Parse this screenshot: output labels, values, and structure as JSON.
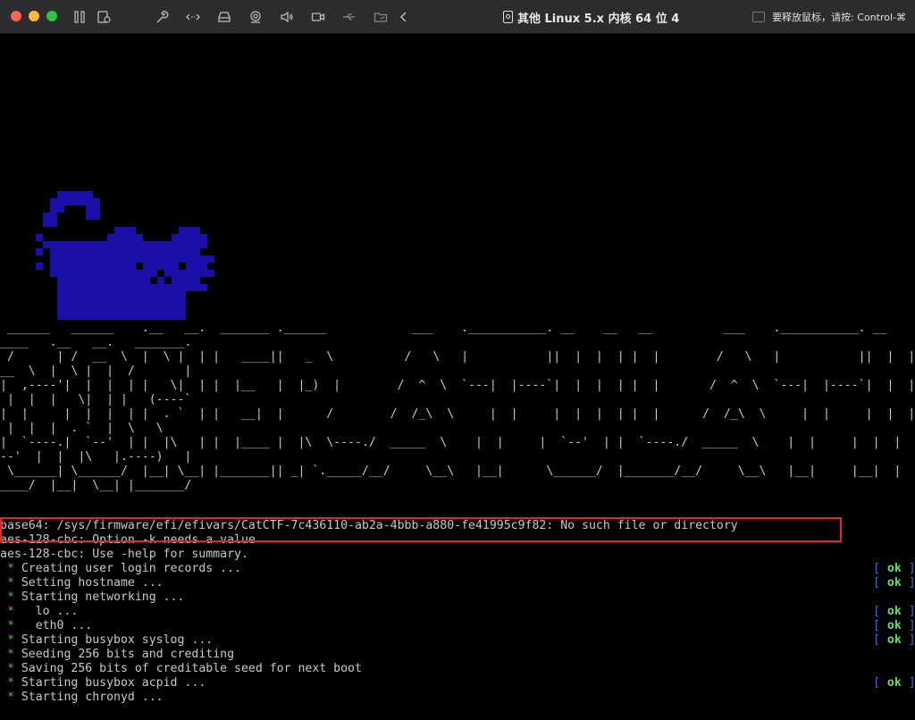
{
  "window": {
    "title": "其他 Linux 5.x 内核 64 位 4",
    "release_hint": "要释放鼠标，请按: Control-⌘",
    "traffic_lights": {
      "close": "#ff5f57",
      "minimize": "#febc2e",
      "maximize": "#28c840"
    }
  },
  "toolbar": {
    "icons": [
      "pause-icon",
      "snapshot-icon",
      "wrench-icon",
      "network-arrows-icon",
      "disk-icon",
      "camera-icon",
      "speaker-icon",
      "video-icon",
      "usb-icon",
      "shared-folder-icon",
      "chevron-left-icon"
    ]
  },
  "logo": {
    "color": "#1a0fa8"
  },
  "banner": {
    "lines": [
      " ______   ______    .__   __.  _______ .______            ___    .___________. __    __   __          ___    .___________. __    __",
      "____   .__   __.   _______.",
      " /      | /  __  \\  |  \\ |  | |   ____||   _  \\          /   \\   |           ||  |  |  | |  |        /   \\   |           ||  |  |",
      "__  \\  |  \\ |  |  /       |",
      "|  ,----'|  |  |  | |   \\|  | |  |__   |  |_)  |        /  ^  \\  `---|  |----`|  |  |  | |  |       /  ^  \\  `---|  |----`|  |  |",
      " |  |  |   \\|  | |   (----`",
      "|  |     |  |  |  | |  . `  | |   __|  |      /        /  /_\\  \\     |  |     |  |  |  | |  |      /  /_\\  \\     |  |     |  |  |",
      " |  |  |  . `  |  \\   \\",
      "|  `----.|  `--'  | |  |\\   | |  |____ |  |\\  \\----./  _____  \\    |  |     |  `--'  | |  `----./  _____  \\    |  |     |  |  |",
      "--'  |  |  |\\   |.----)   |",
      " \\______| \\______/  |__| \\__| |_______|| _| `._____/__/     \\__\\   |__|      \\______/  |_______/__/     \\__\\   |__|     |__|  |",
      "____/  |__|  \\__| |_______/"
    ]
  },
  "console": {
    "lines": [
      {
        "text": "base64: /sys/firmware/efi/efivars/CatCTF-7c436110-ab2a-4bbb-a880-fe41995c9f82: No such file or directory",
        "star": false,
        "ok": false
      },
      {
        "text": "aes-128-cbc: Option -k needs a value",
        "star": false,
        "ok": false
      },
      {
        "text": "aes-128-cbc: Use -help for summary.",
        "star": false,
        "ok": false
      },
      {
        "text": "Creating user login records ...",
        "star": true,
        "ok": true
      },
      {
        "text": "Setting hostname ...",
        "star": true,
        "ok": true
      },
      {
        "text": "Starting networking ...",
        "star": true,
        "ok": false
      },
      {
        "text": "  lo ...",
        "star": true,
        "ok": true
      },
      {
        "text": "  eth0 ...",
        "star": true,
        "ok": true
      },
      {
        "text": "Starting busybox syslog ...",
        "star": true,
        "ok": true
      },
      {
        "text": "Seeding 256 bits and crediting",
        "star": true,
        "ok": false
      },
      {
        "text": "Saving 256 bits of creditable seed for next boot",
        "star": true,
        "ok": false
      },
      {
        "text": "Starting busybox acpid ...",
        "star": true,
        "ok": true
      },
      {
        "text": "Starting chronyd ...",
        "star": true,
        "ok": false
      }
    ],
    "status": {
      "open": "[",
      "ok": "ok",
      "close": "]"
    },
    "star_glyph": "*"
  },
  "highlight": {
    "color": "#e0262a"
  }
}
